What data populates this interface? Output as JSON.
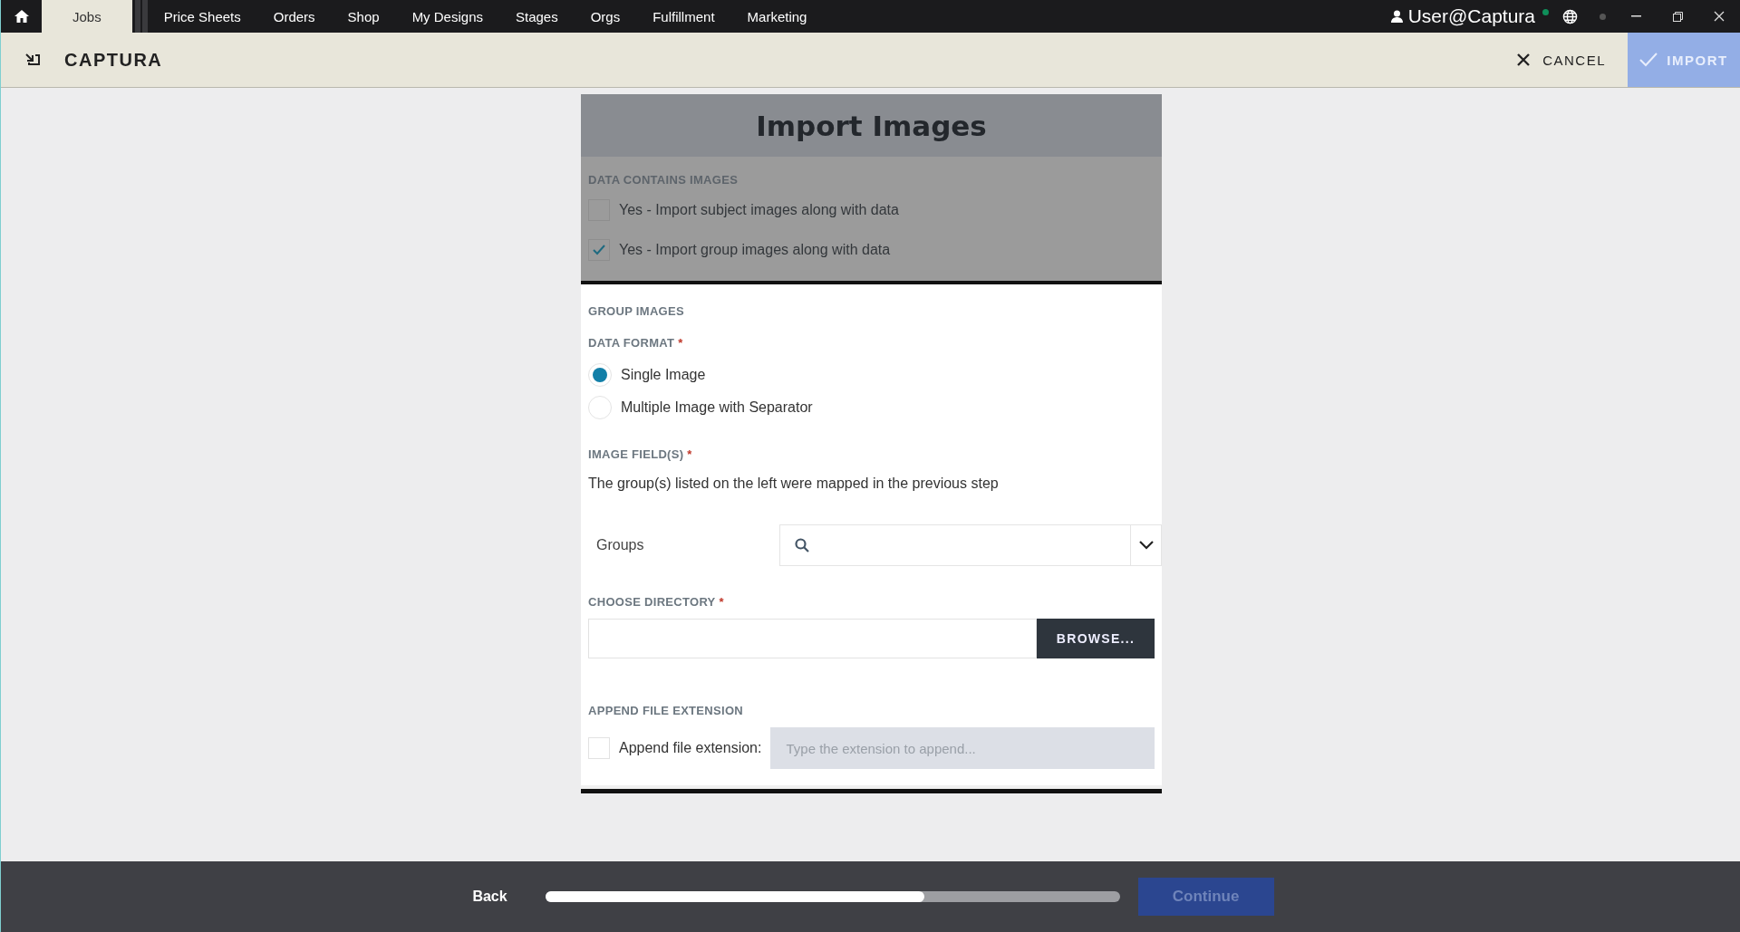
{
  "nav": {
    "tabs": [
      {
        "label": "Jobs",
        "selected": true
      },
      {
        "label": "Price Sheets",
        "selected": false
      },
      {
        "label": "Orders",
        "selected": false
      },
      {
        "label": "Shop",
        "selected": false
      },
      {
        "label": "My Designs",
        "selected": false
      },
      {
        "label": "Stages",
        "selected": false
      },
      {
        "label": "Orgs",
        "selected": false
      },
      {
        "label": "Fulfillment",
        "selected": false
      },
      {
        "label": "Marketing",
        "selected": false
      }
    ],
    "user": "User@Captura"
  },
  "header": {
    "title": "CAPTURA",
    "cancel": "CANCEL",
    "import": {
      "label": "IMPORT",
      "disabled": true
    }
  },
  "form": {
    "title": "Import Images",
    "data_contains": {
      "heading": "DATA CONTAINS IMAGES",
      "options": [
        {
          "label": "Yes - Import subject images along with data",
          "checked": false
        },
        {
          "label": "Yes - Import group images along with data",
          "checked": true
        }
      ]
    },
    "group_heading": "GROUP IMAGES",
    "data_format": {
      "label": "DATA FORMAT",
      "required": "*",
      "options": [
        {
          "label": "Single Image",
          "selected": true
        },
        {
          "label": "Multiple Image with Separator",
          "selected": false
        }
      ]
    },
    "image_fields": {
      "label": "IMAGE FIELD(S)",
      "required": "*",
      "note": "The group(s) listed on the left were mapped in the previous step",
      "row_label": "Groups"
    },
    "directory": {
      "label": "CHOOSE DIRECTORY",
      "required": "*",
      "button": "BROWSE..."
    },
    "append": {
      "heading": "APPEND FILE EXTENSION",
      "label": "Append file extension:",
      "checked": false,
      "placeholder": "Type the extension to append..."
    }
  },
  "footer": {
    "back": "Back",
    "progress": {
      "level": 0.66
    },
    "continue": {
      "label": "Continue",
      "disabled": true
    }
  }
}
